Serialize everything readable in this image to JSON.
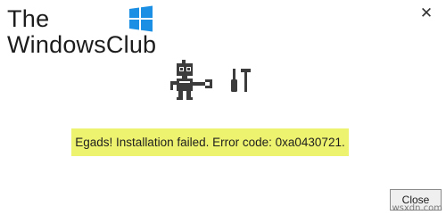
{
  "brand": {
    "line1": "The",
    "line2": "WindowsClub",
    "flag_colors": [
      "#1a8fe3",
      "#1a8fe3",
      "#1a8fe3",
      "#1a8fe3"
    ]
  },
  "window": {
    "close_glyph": "✕"
  },
  "illustration": {
    "icon": "robot-repair-icon",
    "color": "#3c3c3c"
  },
  "error": {
    "message": "Egads! Installation failed. Error code: 0xa0430721.",
    "highlight_color": "#eef36f"
  },
  "actions": {
    "close_label": "Close"
  },
  "watermark": {
    "site": "wsxdn.com"
  }
}
